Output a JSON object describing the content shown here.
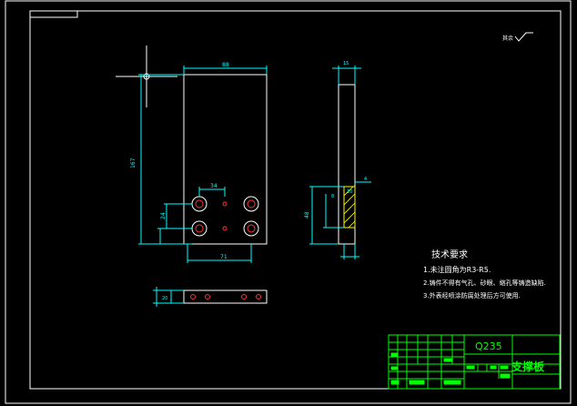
{
  "drawing": {
    "colors": {
      "background": "#000000",
      "border": "#ffffff",
      "frame": "#00ffff",
      "outline": "#ffffff",
      "dimension": "#00ffff",
      "hole": "#ff3333",
      "title_block": "#00ff00",
      "hatch": "#ffff00",
      "note_text": "#ffffff"
    },
    "roughness_symbol_label": "其余",
    "dimensions": {
      "overall_width": "88",
      "overall_height": "167",
      "hole_spacing_x": "34",
      "hole_spacing_y": "24",
      "bottom_spacing": "71",
      "side_thickness": "15",
      "side_height": "48",
      "side_left": "8",
      "side_small": "10",
      "side_right": "4",
      "bottom_height": "20"
    },
    "tech_requirements": {
      "title": "技术要求",
      "items": [
        "1.未注圆角为R3-R5.",
        "2.铸件不得有气孔、砂眼、缩孔等铸造缺陷.",
        "3.外表经喷涂防腐处理后方可使用."
      ]
    },
    "title_block": {
      "material": "Q235",
      "part_name": "支撑板"
    }
  }
}
